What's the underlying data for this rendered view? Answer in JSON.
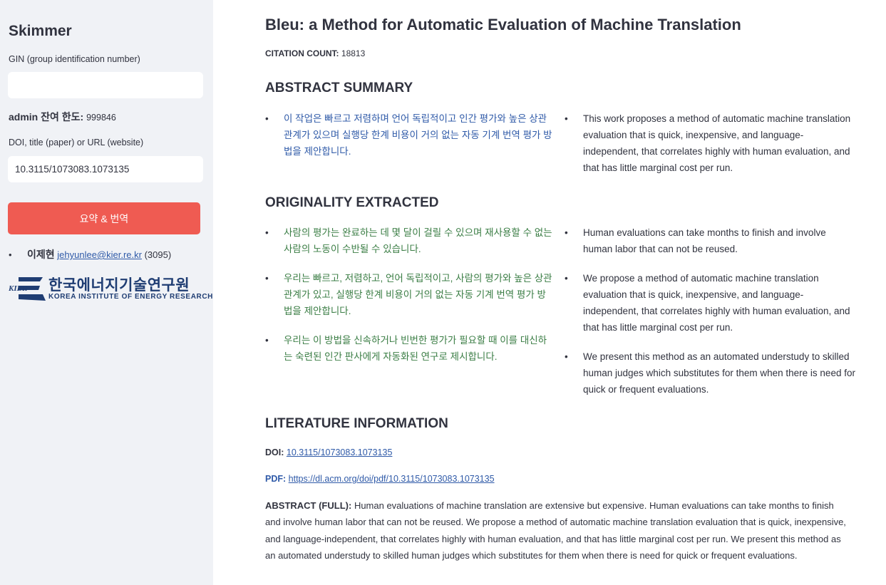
{
  "sidebar": {
    "app_title": "Skimmer",
    "gin_label": "GIN (group identification number)",
    "gin_value": "",
    "admin_label": "admin 잔여 한도:",
    "admin_value": "999846",
    "doi_label": "DOI, title (paper) or URL (website)",
    "doi_value": "10.3115/1073083.1073135",
    "button_label": "요약 & 번역",
    "contact": {
      "name": "이제현",
      "email": "jehyunlee@kier.re.kr",
      "extension": "(3095)"
    },
    "logo": {
      "mark": "KIER",
      "korean": "한국에너지기술연구원",
      "english": "KOREA INSTITUTE OF ENERGY RESEARCH",
      "color": "#1f3d73"
    }
  },
  "main": {
    "title": "Bleu: a Method for Automatic Evaluation of Machine Translation",
    "citation_label": "CITATION COUNT:",
    "citation_value": "18813",
    "abstract_summary": {
      "heading": "ABSTRACT SUMMARY",
      "ko": [
        "이 작업은 빠르고 저렴하며 언어 독립적이고 인간 평가와 높은 상관 관계가 있으며 실행당 한계 비용이 거의 없는 자동 기계 번역 평가 방법을 제안합니다."
      ],
      "en": [
        "This work proposes a method of automatic machine translation evaluation that is quick, inexpensive, and language-independent, that correlates highly with human evaluation, and that has little marginal cost per run."
      ]
    },
    "originality": {
      "heading": "ORIGINALITY EXTRACTED",
      "ko": [
        "사람의 평가는 완료하는 데 몇 달이 걸릴 수 있으며 재사용할 수 없는 사람의 노동이 수반될 수 있습니다.",
        "우리는 빠르고, 저렴하고, 언어 독립적이고, 사람의 평가와 높은 상관관계가 있고, 실행당 한계 비용이 거의 없는 자동 기계 번역 평가 방법을 제안합니다.",
        "우리는 이 방법을 신속하거나 빈번한 평가가 필요할 때 이를 대신하는 숙련된 인간 판사에게 자동화된 연구로 제시합니다."
      ],
      "en": [
        "Human evaluations can take months to finish and involve human labor that can not be reused.",
        "We propose a method of automatic machine translation evaluation that is quick, inexpensive, and language-independent, that correlates highly with human evaluation, and that has little marginal cost per run.",
        "We present this method as an automated understudy to skilled human judges which substitutes for them when there is need for quick or frequent evaluations."
      ]
    },
    "literature": {
      "heading": "LITERATURE INFORMATION",
      "doi_label": "DOI:",
      "doi_link": "10.3115/1073083.1073135",
      "pdf_label": "PDF:",
      "pdf_link": "https://dl.acm.org/doi/pdf/10.3115/1073083.1073135",
      "abstract_label": "ABSTRACT (FULL):",
      "abstract_text": "Human evaluations of machine translation are extensive but expensive. Human evaluations can take months to finish and involve human labor that can not be reused. We propose a method of automatic machine translation evaluation that is quick, inexpensive, and language-independent, that correlates highly with human evaluation, and that has little marginal cost per run. We present this method as an automated understudy to skilled human judges which substitutes for them when there is need for quick or frequent evaluations."
    }
  },
  "colors": {
    "accent": "#ef5b52",
    "link": "#2f5aa8",
    "korean_summary": "#2f5aa8",
    "korean_originality": "#3a7d44",
    "sidebar_bg": "#f0f2f6"
  }
}
